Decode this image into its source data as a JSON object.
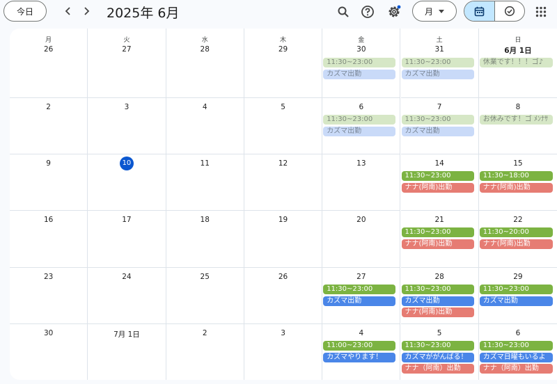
{
  "header": {
    "today_label": "今日",
    "title": "2025年 6月",
    "view_label": "月",
    "icons": [
      "search-icon",
      "help-icon",
      "settings-icon",
      "calendar-icon",
      "task-check-icon",
      "apps-grid-icon"
    ]
  },
  "colors": {
    "green": "#7cb342",
    "blue": "#4a86e8",
    "salmon": "#e67c73",
    "pale_green": "#d6e7c6",
    "pale_blue": "#c9daf8",
    "today_circle": "#0b57d0"
  },
  "weekdays": [
    "月",
    "火",
    "水",
    "木",
    "金",
    "土",
    "日"
  ],
  "weeks": [
    {
      "days": [
        {
          "label": "26",
          "events": []
        },
        {
          "label": "27",
          "events": []
        },
        {
          "label": "28",
          "events": []
        },
        {
          "label": "29",
          "events": []
        },
        {
          "label": "30",
          "events": [
            {
              "text": "11:30~23:00",
              "color": "pale_green"
            },
            {
              "text": "カズマ出勤",
              "color": "pale_blue"
            }
          ]
        },
        {
          "label": "31",
          "events": [
            {
              "text": "11:30~23:00",
              "color": "pale_green"
            },
            {
              "text": "カズマ出勤",
              "color": "pale_blue"
            }
          ]
        },
        {
          "label": "6月 1日",
          "bold": true,
          "events": [
            {
              "text": "休業です！！！ゴ♪",
              "color": "pale_green"
            }
          ]
        }
      ]
    },
    {
      "days": [
        {
          "label": "2",
          "events": []
        },
        {
          "label": "3",
          "events": []
        },
        {
          "label": "4",
          "events": []
        },
        {
          "label": "5",
          "events": []
        },
        {
          "label": "6",
          "events": [
            {
              "text": "11:30~23:00",
              "color": "pale_green"
            },
            {
              "text": "カズマ出勤",
              "color": "pale_blue"
            }
          ]
        },
        {
          "label": "7",
          "events": [
            {
              "text": "11:30~23:00",
              "color": "pale_green"
            },
            {
              "text": "カズマ出勤",
              "color": "pale_blue"
            }
          ]
        },
        {
          "label": "8",
          "events": [
            {
              "text": "お休みです！ゴ ﾒﾝﾅｻ",
              "color": "pale_green"
            }
          ]
        }
      ]
    },
    {
      "days": [
        {
          "label": "9",
          "events": []
        },
        {
          "label": "10",
          "today": true,
          "events": []
        },
        {
          "label": "11",
          "events": []
        },
        {
          "label": "12",
          "events": []
        },
        {
          "label": "13",
          "events": []
        },
        {
          "label": "14",
          "events": [
            {
              "text": "11:30~23:00",
              "color": "green"
            },
            {
              "text": "ナナ(阿南)出勤",
              "color": "salmon"
            }
          ]
        },
        {
          "label": "15",
          "events": [
            {
              "text": "11:30~18:00",
              "color": "green"
            },
            {
              "text": "ナナ(阿南)出勤",
              "color": "salmon"
            }
          ]
        }
      ]
    },
    {
      "days": [
        {
          "label": "16",
          "events": []
        },
        {
          "label": "17",
          "events": []
        },
        {
          "label": "18",
          "events": []
        },
        {
          "label": "19",
          "events": []
        },
        {
          "label": "20",
          "events": []
        },
        {
          "label": "21",
          "events": [
            {
              "text": "11:30~23:00",
              "color": "green"
            },
            {
              "text": "ナナ(阿南)出勤",
              "color": "salmon"
            }
          ]
        },
        {
          "label": "22",
          "events": [
            {
              "text": "11:30~20:00",
              "color": "green"
            },
            {
              "text": "ナナ(阿南)出勤",
              "color": "salmon"
            }
          ]
        }
      ]
    },
    {
      "days": [
        {
          "label": "23",
          "events": []
        },
        {
          "label": "24",
          "events": []
        },
        {
          "label": "25",
          "events": []
        },
        {
          "label": "26",
          "events": []
        },
        {
          "label": "27",
          "events": [
            {
              "text": "11:30~23:00",
              "color": "green"
            },
            {
              "text": "カズマ出勤",
              "color": "blue"
            }
          ]
        },
        {
          "label": "28",
          "events": [
            {
              "text": "11:30~23:00",
              "color": "green"
            },
            {
              "text": "カズマ出勤",
              "color": "blue"
            },
            {
              "text": "ナナ(阿南)出勤",
              "color": "salmon"
            }
          ]
        },
        {
          "label": "29",
          "events": [
            {
              "text": "11:30~23:00",
              "color": "green"
            },
            {
              "text": "カズマ出勤",
              "color": "blue"
            }
          ]
        }
      ]
    },
    {
      "days": [
        {
          "label": "30",
          "events": []
        },
        {
          "label": "7月 1日",
          "events": []
        },
        {
          "label": "2",
          "events": []
        },
        {
          "label": "3",
          "events": []
        },
        {
          "label": "4",
          "events": [
            {
              "text": "11:00~23:00",
              "color": "green"
            },
            {
              "text": "カズマやります！",
              "color": "blue"
            }
          ]
        },
        {
          "label": "5",
          "events": [
            {
              "text": "11:30~23:00",
              "color": "green"
            },
            {
              "text": "カズマががんばる！",
              "color": "blue"
            },
            {
              "text": "ナナ（阿南）出勤",
              "color": "salmon"
            }
          ]
        },
        {
          "label": "6",
          "events": [
            {
              "text": "11:30~23:00",
              "color": "green"
            },
            {
              "text": "カズマ日曜もいるよ",
              "color": "blue"
            },
            {
              "text": "ナナ（阿南）出勤",
              "color": "salmon"
            }
          ]
        }
      ]
    }
  ]
}
